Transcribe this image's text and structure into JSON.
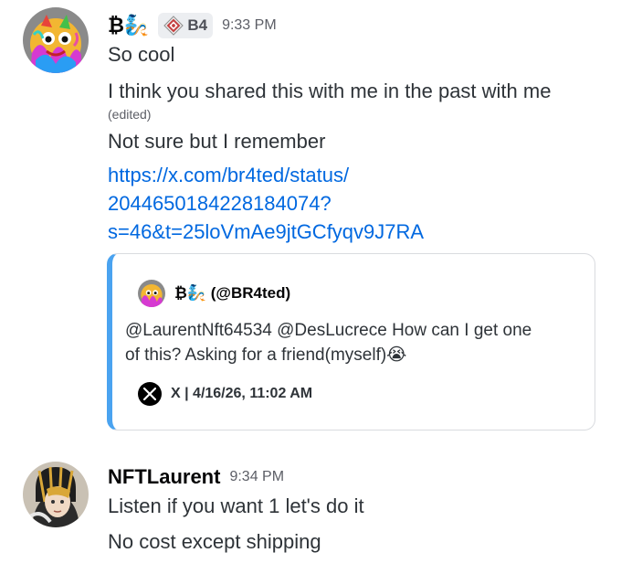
{
  "messages": [
    {
      "author": "₿🧞",
      "tag": "B4",
      "tag_icon": "diamond-guild-icon",
      "time": "9:33 PM",
      "lines": [
        "So cool",
        "I think you shared this with me in the past with me"
      ],
      "edited_label": "(edited)",
      "line3": "Not sure but I remember",
      "link_lines": [
        "https://x.com/br4ted/status/",
        "2044650184228184074?",
        "s=46&t=25loVmAe9jtGCfyqv9J7RA"
      ],
      "embed": {
        "author": "₿🧞 (@BR4ted)",
        "description_line1": "@LaurentNft64534 @DesLucrece How can I get one",
        "description_line2": "of this? Asking for a friend(myself)😭",
        "footer": "X | 4/16/26, 11:02 AM",
        "accent_color": "#4aa3f0"
      }
    },
    {
      "author": "NFTLaurent",
      "time": "9:34 PM",
      "lines": [
        "Listen if you want 1 let's do it",
        "No cost except shipping"
      ]
    }
  ],
  "colors": {
    "link": "#0068e0",
    "text": "#2e3338",
    "muted": "#5c5e66"
  }
}
